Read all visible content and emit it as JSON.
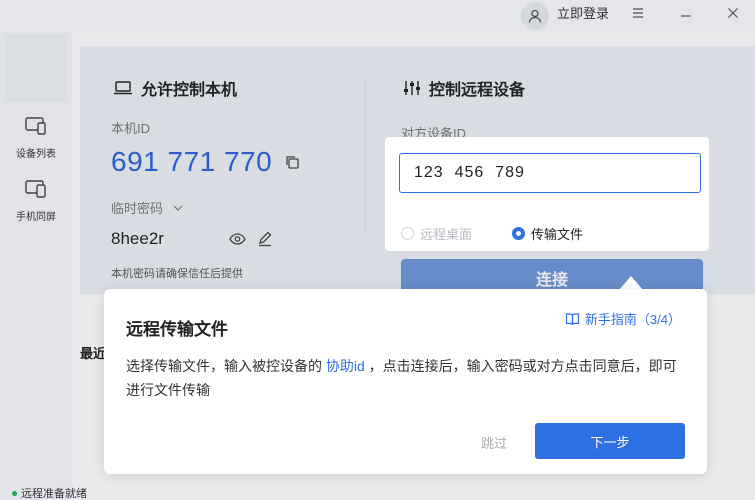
{
  "header": {
    "login_label": "立即登录"
  },
  "sidebar": {
    "items": [
      {
        "label": "设备列表",
        "icon": "device-list-icon"
      },
      {
        "label": "手机同屏",
        "icon": "phone-mirror-icon"
      }
    ]
  },
  "local": {
    "title": "允许控制本机",
    "id_label": "本机ID",
    "device_id": "691 771 770",
    "password_label": "临时密码",
    "password": "8hee2r",
    "note": "本机密码请确保信任后提供"
  },
  "remote": {
    "title": "控制远程设备",
    "id_label": "对方设备ID",
    "id_value": "123  456  789",
    "options": [
      {
        "label": "远程桌面",
        "checked": false
      },
      {
        "label": "传输文件",
        "checked": true
      }
    ],
    "connect_label": "连接"
  },
  "recent_label": "最近",
  "status": {
    "text": "远程准备就绪"
  },
  "guide": {
    "title": "远程传输文件",
    "guide_link": "新手指南（3/4）",
    "body_before": "选择传输文件，输入被控设备的 ",
    "body_highlight": "协助id",
    "body_after": " ，点击连接后，输入密码或对方点击同意后，即可进行文件传输",
    "skip_label": "跳过",
    "next_label": "下一步"
  },
  "colors": {
    "accent": "#2f6fe4",
    "id_blue": "#2a63d8",
    "status_green": "#2bb45b"
  }
}
